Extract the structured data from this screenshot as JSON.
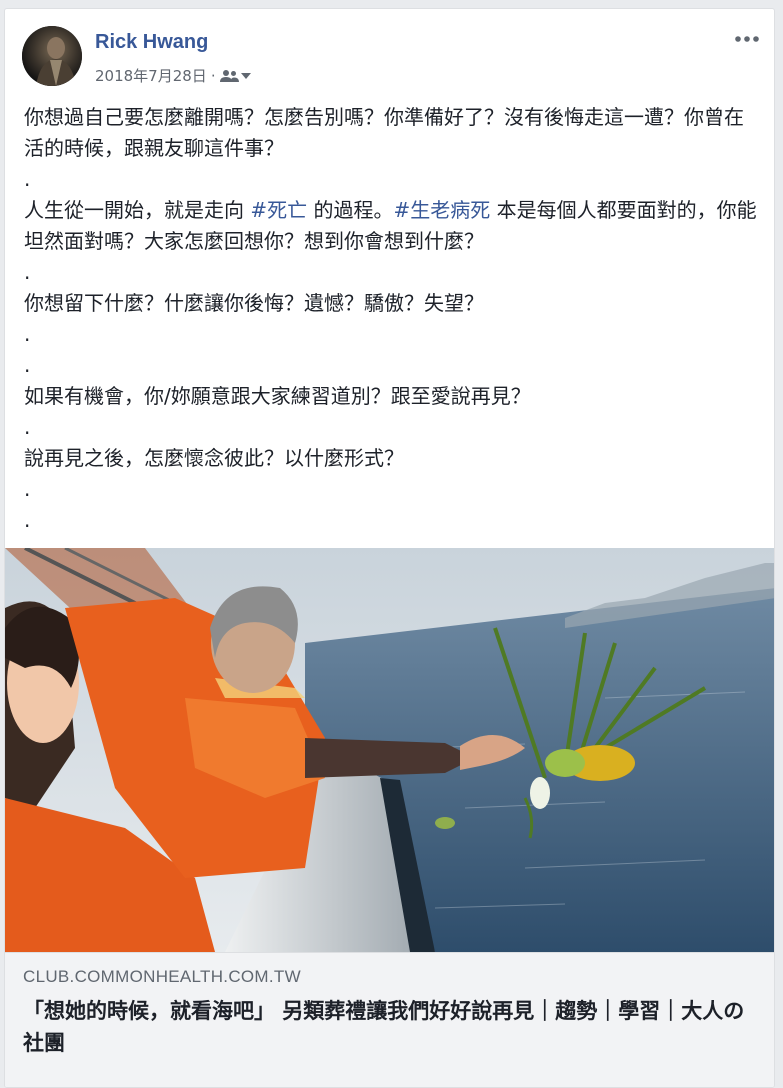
{
  "post": {
    "author": "Rick Hwang",
    "date": "2018年7月28日",
    "meta_sep": "·",
    "audience_icon": "friends-icon",
    "menu_icon": "more-options-icon",
    "lines": [
      "你想過自己要怎麼離開嗎？怎麼告別嗎？你準備好了？沒有後悔走這一遭？你曾在活的時候，跟親友聊這件事？",
      ".",
      "",
      ".",
      "你想留下什麼？什麼讓你後悔？遺憾？驕傲？失望？",
      ".",
      ".",
      "如果有機會，你/妳願意跟大家練習道別？跟至愛說再見？",
      ".",
      "說再見之後，怎麼懷念彼此？以什麼形式？",
      ".",
      "."
    ],
    "para2": {
      "part1": "人生從一開始，就是走向 ",
      "tag1": "#死亡",
      "part2": " 的過程。",
      "tag2": "#生老病死",
      "part3": " 本是每個人都要面對的，你能坦然面對嗎？大家怎麼回想你？想到你會想到什麼？"
    }
  },
  "link": {
    "domain": "CLUB.COMMONHEALTH.COM.TW",
    "title": "「想她的時候，就看海吧」 另類葬禮讓我們好好說再見｜趨勢｜學習｜大人の社團"
  },
  "colors": {
    "link_blue": "#385898",
    "text": "#1d2129",
    "meta": "#616770",
    "background": "#e9ebee",
    "link_box": "#f2f3f5"
  }
}
